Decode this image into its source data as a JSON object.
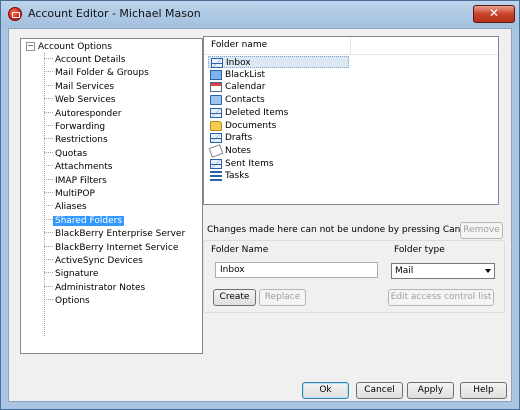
{
  "window": {
    "title": "Account Editor - Michael Mason",
    "close_symbol": "✕"
  },
  "tree": {
    "root_label": "Account Options",
    "root_expander": "−",
    "items": [
      "Account Details",
      "Mail Folder & Groups",
      "Mail Services",
      "Web Services",
      "Autoresponder",
      "Forwarding",
      "Restrictions",
      "Quotas",
      "Attachments",
      "IMAP Filters",
      "MultiPOP",
      "Aliases",
      "Shared Folders",
      "BlackBerry Enterprise Server",
      "BlackBerry Internet Service",
      "ActiveSync Devices",
      "Signature",
      "Administrator Notes",
      "Options"
    ],
    "selected": "Shared Folders"
  },
  "folder_list": {
    "column_header": "Folder name",
    "rows": [
      {
        "name": "Inbox",
        "icon": "mail-icon"
      },
      {
        "name": "BlackList",
        "icon": "book-icon"
      },
      {
        "name": "Calendar",
        "icon": "calendar-icon"
      },
      {
        "name": "Contacts",
        "icon": "contacts-icon"
      },
      {
        "name": "Deleted Items",
        "icon": "mail-icon"
      },
      {
        "name": "Documents",
        "icon": "folder-icon"
      },
      {
        "name": "Drafts",
        "icon": "mail-icon"
      },
      {
        "name": "Notes",
        "icon": "notes-icon"
      },
      {
        "name": "Sent Items",
        "icon": "mail-icon"
      },
      {
        "name": "Tasks",
        "icon": "tasks-icon"
      }
    ],
    "selected": "Inbox"
  },
  "warning_text": "Changes made here can not be undone by pressing Cancel.",
  "buttons": {
    "remove": "Remove",
    "create": "Create",
    "replace": "Replace",
    "edit_acl": "Edit access control list",
    "ok": "Ok",
    "cancel": "Cancel",
    "apply": "Apply",
    "help": "Help"
  },
  "form": {
    "folder_name_label": "Folder Name",
    "folder_name_value": "Inbox",
    "folder_type_label": "Folder type",
    "folder_type_value": "Mail"
  },
  "colors": {
    "selection": "#3399ff",
    "title_bar": "#bcd4ec",
    "close_button": "#c9432a"
  }
}
